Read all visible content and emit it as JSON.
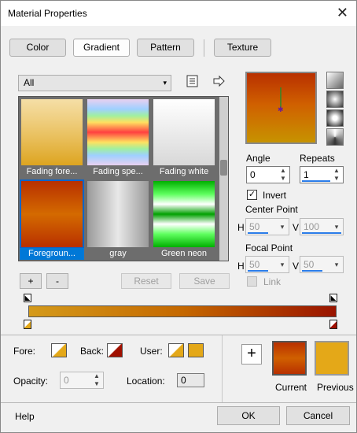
{
  "window": {
    "title": "Material Properties",
    "close": "✕"
  },
  "tabs": [
    {
      "label": "Color"
    },
    {
      "label": "Gradient"
    },
    {
      "label": "Pattern"
    },
    {
      "label": "Texture"
    }
  ],
  "category": {
    "value": "All",
    "arrow": "▾"
  },
  "gallery": {
    "items": [
      {
        "label": "Fading fore..."
      },
      {
        "label": "Fading spe..."
      },
      {
        "label": "Fading white"
      },
      {
        "label": "Foregroun..."
      },
      {
        "label": "gray"
      },
      {
        "label": "Green neon"
      }
    ]
  },
  "buttons": {
    "add": "+",
    "remove": "-",
    "reset": "Reset",
    "save": "Save",
    "ok": "OK",
    "cancel": "Cancel",
    "help": "Help",
    "add_swatch": "+"
  },
  "angle": {
    "label": "Angle",
    "value": "0"
  },
  "repeats": {
    "label": "Repeats",
    "value": "1"
  },
  "invert": {
    "label": "Invert",
    "checked": true,
    "mark": "✓"
  },
  "center_point": {
    "label": "Center Point",
    "h_label": "H",
    "h_value": "50",
    "v_label": "V",
    "v_value": "100"
  },
  "focal_point": {
    "label": "Focal Point",
    "h_label": "H",
    "h_value": "50",
    "v_label": "V",
    "v_value": "50"
  },
  "link": {
    "label": "Link"
  },
  "bottom": {
    "fore_label": "Fore:",
    "back_label": "Back:",
    "user_label": "User:",
    "opacity_label": "Opacity:",
    "opacity_value": "0",
    "location_label": "Location:",
    "location_value": "0",
    "current_label": "Current",
    "previous_label": "Previous"
  },
  "icons": {
    "list": "list-icon",
    "arrow": "arrow-right-icon"
  },
  "colors": {
    "current": "#c05a00",
    "previous": "#e4a818",
    "accent": "#0078d7"
  }
}
